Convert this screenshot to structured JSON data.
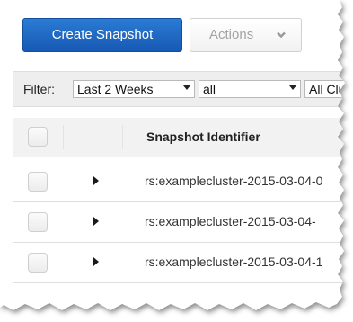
{
  "toolbar": {
    "create_snapshot_label": "Create Snapshot",
    "actions_label": "Actions"
  },
  "filter": {
    "label": "Filter:",
    "date_range": {
      "selected": "Last 2 Weeks"
    },
    "snapshot_type": {
      "selected": "all"
    },
    "cluster": {
      "selected": "All Clu"
    }
  },
  "table": {
    "columns": [
      "Snapshot Identifier"
    ],
    "rows": [
      {
        "snapshot_identifier": "rs:examplecluster-2015-03-04-0"
      },
      {
        "snapshot_identifier": "rs:examplecluster-2015-03-04-"
      },
      {
        "snapshot_identifier": "rs:examplecluster-2015-03-04-1"
      }
    ]
  },
  "colors": {
    "primary_button": "#1a63c0",
    "filter_bar_bg": "#eeeeee",
    "header_bg": "#f2f2f2"
  }
}
